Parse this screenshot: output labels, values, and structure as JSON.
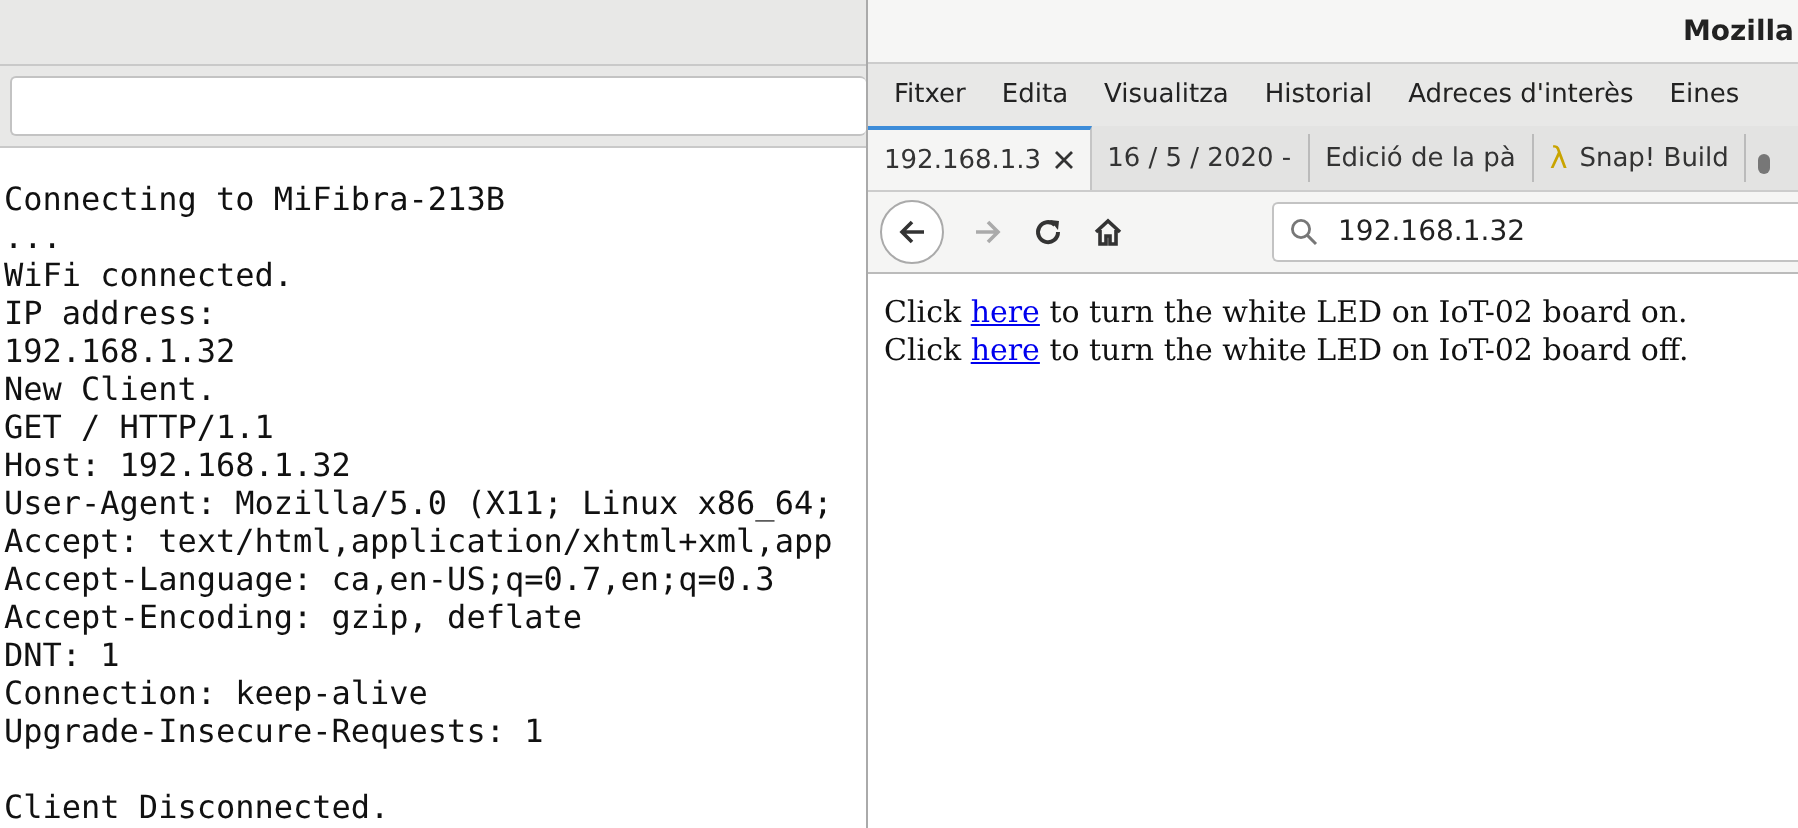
{
  "serial_monitor": {
    "output_lines": [
      "Connecting to MiFibra-213B",
      "...",
      "WiFi connected.",
      "IP address:",
      "192.168.1.32",
      "New Client.",
      "GET / HTTP/1.1",
      "Host: 192.168.1.32",
      "User-Agent: Mozilla/5.0 (X11; Linux x86_64;",
      "Accept: text/html,application/xhtml+xml,app",
      "Accept-Language: ca,en-US;q=0.7,en;q=0.3",
      "Accept-Encoding: gzip, deflate",
      "DNT: 1",
      "Connection: keep-alive",
      "Upgrade-Insecure-Requests: 1"
    ],
    "lines_after_blank": [
      "Client Disconnected."
    ]
  },
  "browser": {
    "window": {
      "title": "Mozilla"
    },
    "menu": [
      "Fitxer",
      "Edita",
      "Visualitza",
      "Historial",
      "Adreces d'interès",
      "Eines"
    ],
    "tabs": [
      {
        "label": "192.168.1.3",
        "selected": true
      },
      {
        "label": "16 / 5 / 2020 -",
        "selected": false
      },
      {
        "label": "Edició de la pà",
        "selected": false
      },
      {
        "icon_char": "λ",
        "label": "Snap! Build",
        "selected": false
      }
    ],
    "nav": {
      "back_enabled": true,
      "forward_enabled": false
    },
    "address_bar": {
      "value": "192.168.1.32"
    },
    "page_lines": [
      {
        "before": "Click ",
        "link": "here",
        "after": " to turn the white LED on IoT-02 board on."
      },
      {
        "before": "Click ",
        "link": "here",
        "after": " to turn the white LED on IoT-02 board off."
      }
    ]
  }
}
